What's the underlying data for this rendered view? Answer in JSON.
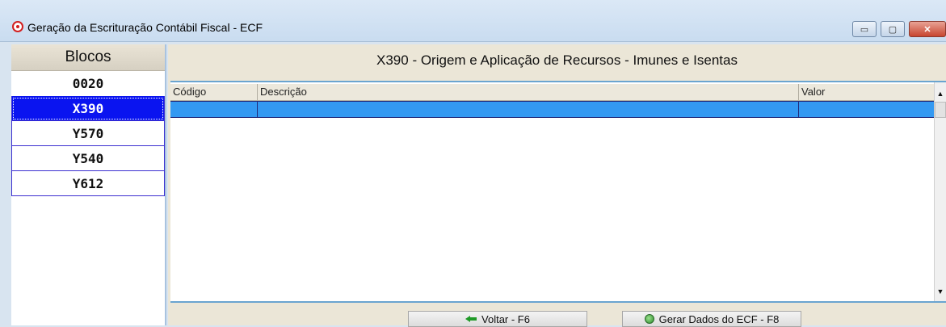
{
  "window": {
    "title": "Geração da Escrituração Contábil Fiscal - ECF",
    "controls": {
      "minimize": "▭",
      "maximize": "▢",
      "close": "✕"
    }
  },
  "sidebar": {
    "header": "Blocos",
    "items": [
      {
        "label": "0020",
        "selected": false
      },
      {
        "label": "X390",
        "selected": true
      },
      {
        "label": "Y570",
        "selected": false
      },
      {
        "label": "Y540",
        "selected": false
      },
      {
        "label": "Y612",
        "selected": false
      }
    ]
  },
  "main": {
    "title": "X390 - Origem e Aplicação de Recursos - Imunes e Isentas",
    "grid": {
      "columns": [
        "Código",
        "Descrição",
        "Valor"
      ],
      "rows": [
        {
          "codigo": "",
          "descricao": "",
          "valor": ""
        }
      ]
    },
    "buttons": {
      "voltar": "Voltar - F6",
      "gerar": "Gerar Dados do ECF - F8"
    }
  },
  "colors": {
    "selected_block": "#0a14f0",
    "selected_row": "#3399f2"
  }
}
